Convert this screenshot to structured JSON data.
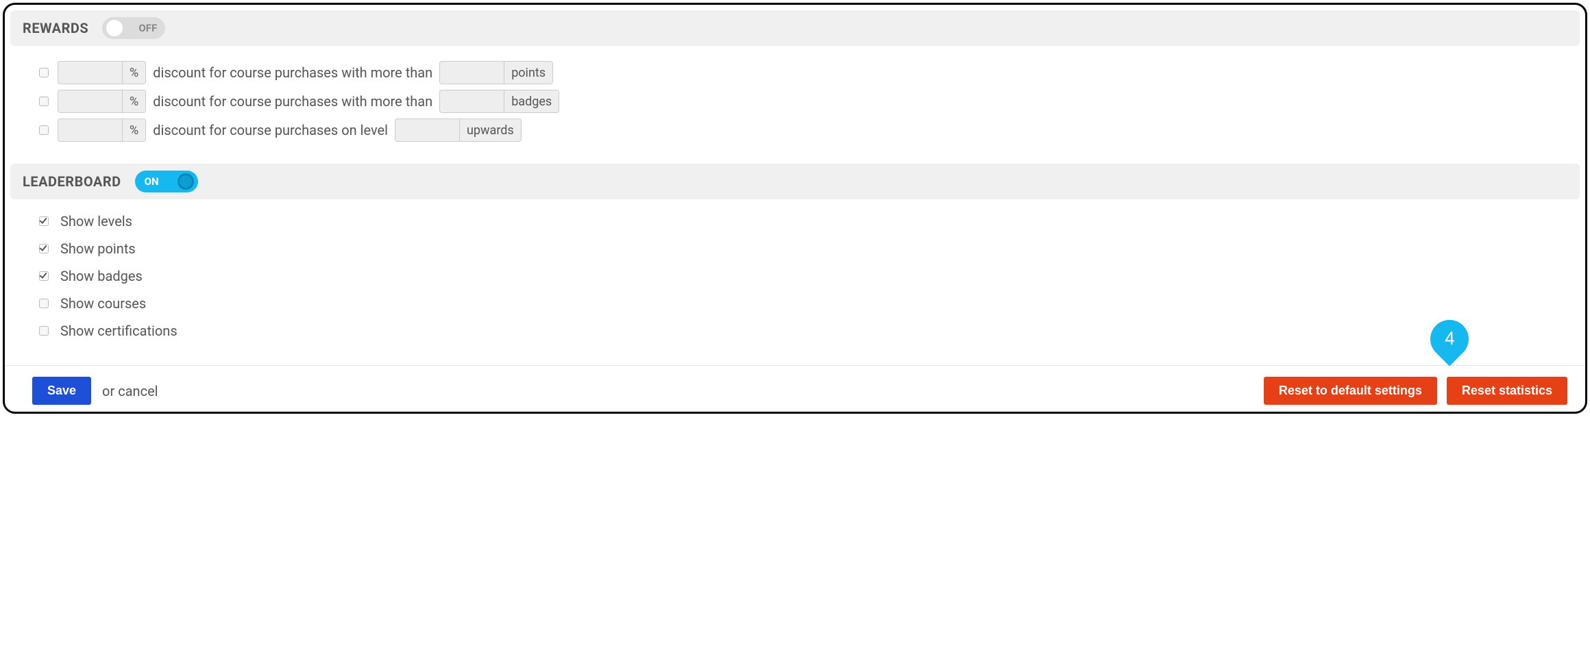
{
  "rewards": {
    "title": "REWARDS",
    "toggle_state_label": "OFF",
    "rows": [
      {
        "percent_suffix": "%",
        "text1": "discount for course purchases with more than",
        "unit": "points"
      },
      {
        "percent_suffix": "%",
        "text1": "discount for course purchases with more than",
        "unit": "badges"
      },
      {
        "percent_suffix": "%",
        "text1": "discount for course purchases on level",
        "unit": "upwards"
      }
    ]
  },
  "leaderboard": {
    "title": "LEADERBOARD",
    "toggle_state_label": "ON",
    "items": [
      {
        "label": "Show levels",
        "checked": true
      },
      {
        "label": "Show points",
        "checked": true
      },
      {
        "label": "Show badges",
        "checked": true
      },
      {
        "label": "Show courses",
        "checked": false
      },
      {
        "label": "Show certifications",
        "checked": false
      }
    ]
  },
  "footer": {
    "save": "Save",
    "or_cancel_prefix": "or ",
    "cancel": "cancel",
    "reset_defaults": "Reset to default settings",
    "reset_stats": "Reset statistics",
    "balloon_number": "4"
  }
}
